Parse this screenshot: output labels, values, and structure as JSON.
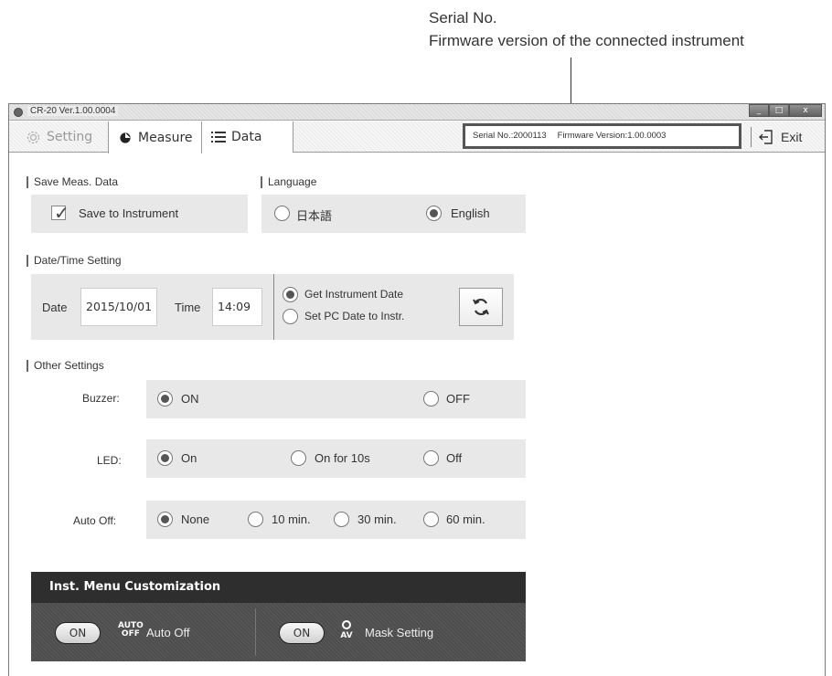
{
  "callout": {
    "line1": "Serial No.",
    "line2": "Firmware version of the connected instrument"
  },
  "window": {
    "title": "CR-20 Ver.1.00.0004",
    "controls": {
      "minimize": "_",
      "maximize": "□",
      "close": "x"
    }
  },
  "tabs": [
    {
      "label": "Setting",
      "icon": "gear-icon"
    },
    {
      "label": "Measure",
      "icon": "droplet-icon"
    },
    {
      "label": "Data",
      "icon": "list-icon"
    }
  ],
  "instrument": {
    "serial": "Serial No.:2000113",
    "firmware": "Firmware Version:1.00.0003"
  },
  "exit": {
    "label": "Exit",
    "icon": "exit-icon"
  },
  "save": {
    "section": "Save Meas. Data",
    "checkbox_label": "Save to Instrument",
    "checked": true
  },
  "language": {
    "section": "Language",
    "options": [
      "日本語",
      "English"
    ],
    "selected": "English"
  },
  "datetime": {
    "section": "Date/Time Setting",
    "date_label": "Date",
    "date_value": "2015/10/01",
    "time_label": "Time",
    "time_value": "14:09",
    "options": [
      "Get Instrument Date",
      "Set PC Date to Instr."
    ],
    "selected": "Get Instrument Date",
    "sync_icon": "refresh-icon"
  },
  "other": {
    "section": "Other Settings",
    "buzzer": {
      "label": "Buzzer:",
      "options": [
        "ON",
        "OFF"
      ],
      "selected": "ON"
    },
    "led": {
      "label": "LED:",
      "options": [
        "On",
        "On for 10s",
        "Off"
      ],
      "selected": "On"
    },
    "auto_off": {
      "label": "Auto Off:",
      "options": [
        "None",
        "10 min.",
        "30 min.",
        "60 min."
      ],
      "selected": "None"
    }
  },
  "inst_menu": {
    "title": "Inst. Menu Customization",
    "items": [
      {
        "button": "ON",
        "icon_text": "AUTO OFF",
        "label": "Auto Off"
      },
      {
        "button": "ON",
        "icon_text": "AV",
        "label": "Mask Setting"
      }
    ]
  },
  "colors": {
    "accent_dark": "#2e2e2e",
    "panel_bg": "#e8e8e8",
    "highlight_border": "#555555"
  }
}
